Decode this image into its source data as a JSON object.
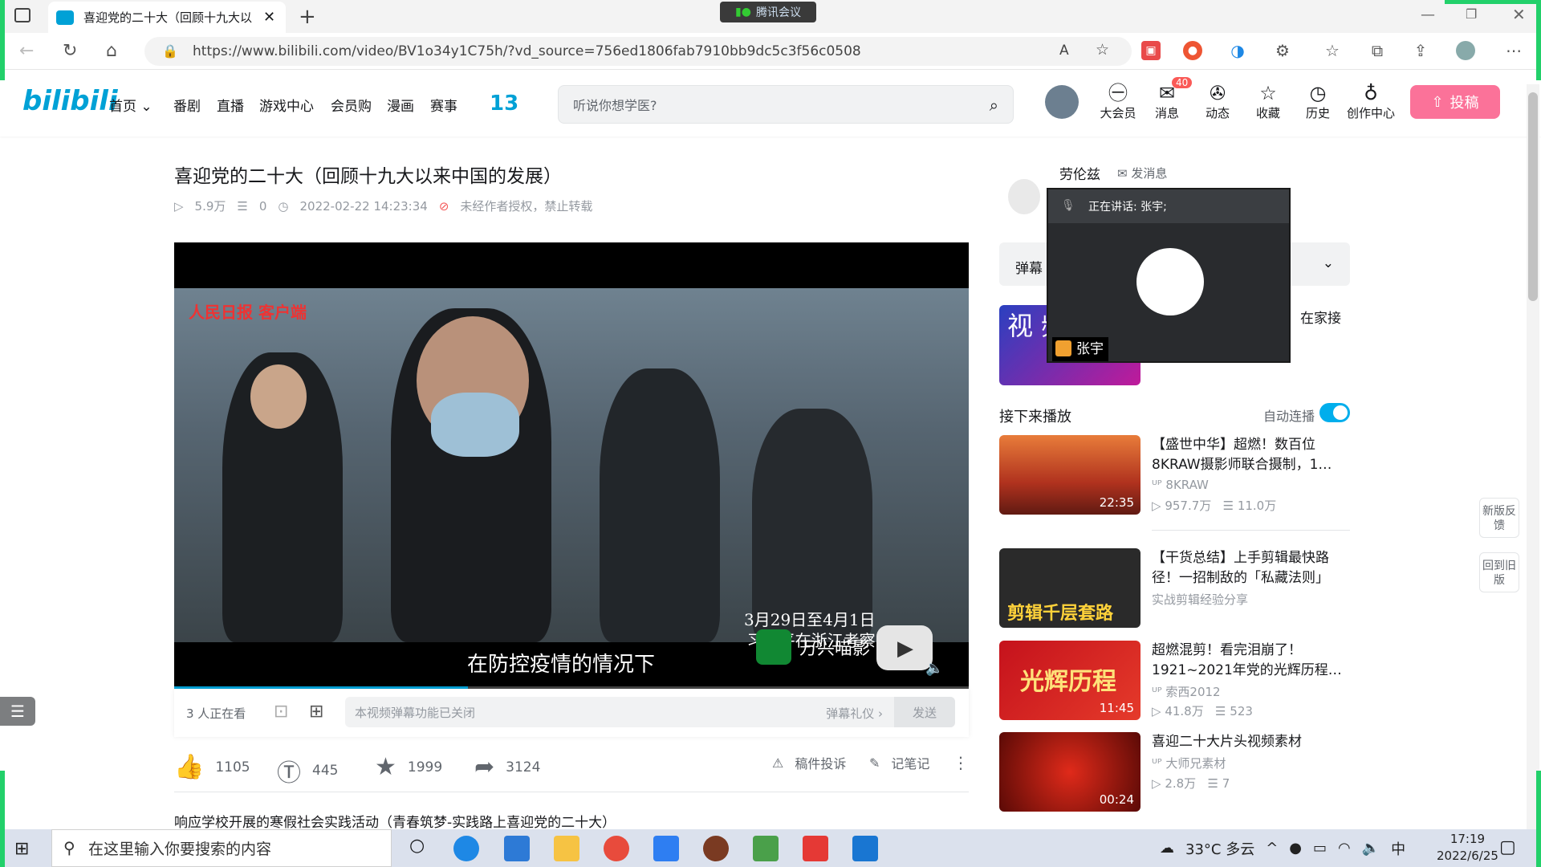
{
  "browser": {
    "tab_title": "喜迎党的二十大（回顾十九大以来",
    "url": "https://www.bilibili.com/video/BV1o34y1C75h/?vd_source=756ed1806fab7910bb9dc5c3f56c0508",
    "read_aloud": "A",
    "meeting_badge": "腾讯会议"
  },
  "site": {
    "logo": "bilibili",
    "nav": [
      "首页",
      "番剧",
      "直播",
      "游戏中心",
      "会员购",
      "漫画",
      "赛事"
    ],
    "search_placeholder": "听说你想学医?",
    "header_icons": [
      {
        "label": "大会员",
        "icon": "vip-icon"
      },
      {
        "label": "消息",
        "icon": "message-icon",
        "badge": "40"
      },
      {
        "label": "动态",
        "icon": "dynamic-icon"
      },
      {
        "label": "收藏",
        "icon": "favorite-icon"
      },
      {
        "label": "历史",
        "icon": "history-icon"
      },
      {
        "label": "创作中心",
        "icon": "creator-icon"
      }
    ],
    "upload_label": "投稿"
  },
  "video": {
    "title": "喜迎党的二十大（回顾十九大以来中国的发展）",
    "views": "5.9万",
    "danmaku_count": "0",
    "date": "2022-02-22 14:23:34",
    "copyright": "未经作者授权，禁止转载",
    "subtitle": "在防控疫情的情况下",
    "date_caption_1": "3月29日至4月1日",
    "date_caption_2": "习近平在浙江考察",
    "watermark": "万兴喵影",
    "source_logo": "人民日报 客户端",
    "progress_pct": 37,
    "watching": "3 人正在看",
    "dm_placeholder": "本视频弹幕功能已关闭",
    "dm_etiquette": "弹幕礼仪 ›",
    "dm_send": "发送",
    "likes": "1105",
    "coins": "445",
    "favorites": "1999",
    "shares": "3124",
    "report": "稿件投诉",
    "notes": "记笔记",
    "description": "响应学校开展的寒假社会实践活动（青春筑梦-实践路上喜迎党的二十大）"
  },
  "sidebar": {
    "uploader": "劳伦兹",
    "message_btn": "发消息",
    "danmaku_header": "弹幕",
    "promo_text": "在家接",
    "promo_chars": "视 频",
    "next_header": "接下来播放",
    "autoplay_label": "自动连播",
    "recs": [
      {
        "title": "【盛世中华】超燃！数百位8KRAW摄影师联合摄制，1…",
        "up": "8KRAW",
        "views": "957.7万",
        "danmaku": "11.0万",
        "duration": "22:35"
      },
      {
        "title": "【干货总结】上手剪辑最快路径！一招制敌的「私藏法则」",
        "up": "实战剪辑经验分享",
        "views": "",
        "danmaku": "",
        "duration": "",
        "thumb_text": "剪辑千层套路"
      },
      {
        "title": "超燃混剪！看完泪崩了！1921~2021年党的光辉历程…",
        "up": "索西2012",
        "views": "41.8万",
        "danmaku": "523",
        "duration": "11:45",
        "thumb_text": "光辉历程"
      },
      {
        "title": "喜迎二十大片头视频素材",
        "up": "大师兄素材",
        "views": "2.8万",
        "danmaku": "7",
        "duration": "00:24"
      }
    ],
    "new_feedback": "新版反馈",
    "back_old": "回到旧版"
  },
  "meeting": {
    "speaking": "正在讲话: 张宇;",
    "participant": "张宇"
  },
  "taskbar": {
    "search_placeholder": "在这里输入你要搜索的内容",
    "weather": "33°C 多云",
    "ime": "中",
    "time": "17:19",
    "date": "2022/6/25"
  }
}
